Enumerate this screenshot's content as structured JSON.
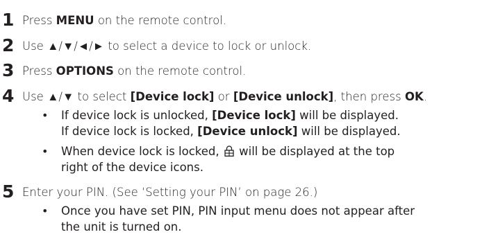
{
  "steps": [
    {
      "num": "1",
      "parts": [
        "Press ",
        "MENU",
        " on the remote control."
      ]
    },
    {
      "num": "2",
      "parts": [
        "Use ▲/▼/◄/► to select a device to lock or unlock."
      ]
    },
    {
      "num": "3",
      "parts": [
        "Press ",
        "OPTIONS",
        " on the remote control."
      ]
    },
    {
      "num": "4",
      "parts": [
        "Use ▲/▼ to select ",
        "[Device lock]",
        " or ",
        "[Device unlock]",
        ", then press ",
        "OK",
        "."
      ],
      "bullets": [
        {
          "line1": [
            "If device lock is unlocked, ",
            "[Device lock]",
            " will be displayed."
          ],
          "line2": [
            "If device lock is locked, ",
            "[Device unlock]",
            " will be displayed."
          ]
        },
        {
          "line1_before": "When device lock is locked, ",
          "line1_after": " will be displayed at the top",
          "line2": "right of the device icons."
        }
      ]
    },
    {
      "num": "5",
      "parts": [
        "Enter your PIN. (See ‘Setting your PIN’ on page 26.)"
      ],
      "bullets": [
        {
          "line1": "Once you have set PIN, PIN input menu does not appear after",
          "line2": "the unit is turned on."
        }
      ]
    }
  ],
  "icons": {
    "lock": "lock-icon"
  }
}
